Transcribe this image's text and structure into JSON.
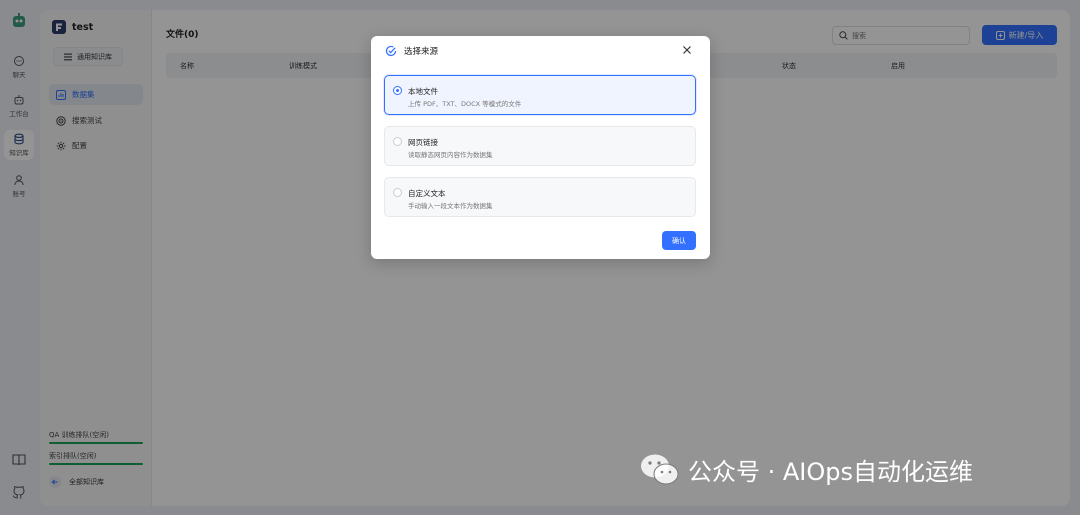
{
  "rail": {
    "items": [
      {
        "label": "聊天",
        "icon": "chat-icon"
      },
      {
        "label": "工作台",
        "icon": "robot-icon"
      },
      {
        "label": "知识库",
        "icon": "database-icon"
      },
      {
        "label": "账号",
        "icon": "user-icon"
      }
    ]
  },
  "panel": {
    "kb_name": "test",
    "kb_type": "通用知识库",
    "nav": [
      {
        "label": "数据集",
        "icon": "chart-icon"
      },
      {
        "label": "搜索测试",
        "icon": "target-icon"
      },
      {
        "label": "配置",
        "icon": "gear-icon"
      }
    ],
    "queues": [
      "QA 训练排队(空闲)",
      "索引排队(空闲)"
    ],
    "all_kb": "全部知识库"
  },
  "main": {
    "title": "文件(0)",
    "search_placeholder": "搜索",
    "new_button": "新建/导入",
    "columns": [
      "名称",
      "训练模式",
      "状态",
      "启用"
    ]
  },
  "modal": {
    "title": "选择来源",
    "options": [
      {
        "title": "本地文件",
        "desc": "上传 PDF、TXT、DOCX 等模式的文件",
        "selected": true
      },
      {
        "title": "网页链接",
        "desc": "读取静态网页内容作为数据集",
        "selected": false
      },
      {
        "title": "自定义文本",
        "desc": "手动输入一段文本作为数据集",
        "selected": false
      }
    ],
    "confirm": "确认"
  },
  "watermark": "公众号 · AIOps自动化运维",
  "colors": {
    "accent": "#3370ff",
    "queue_bar": "#19a05a"
  }
}
